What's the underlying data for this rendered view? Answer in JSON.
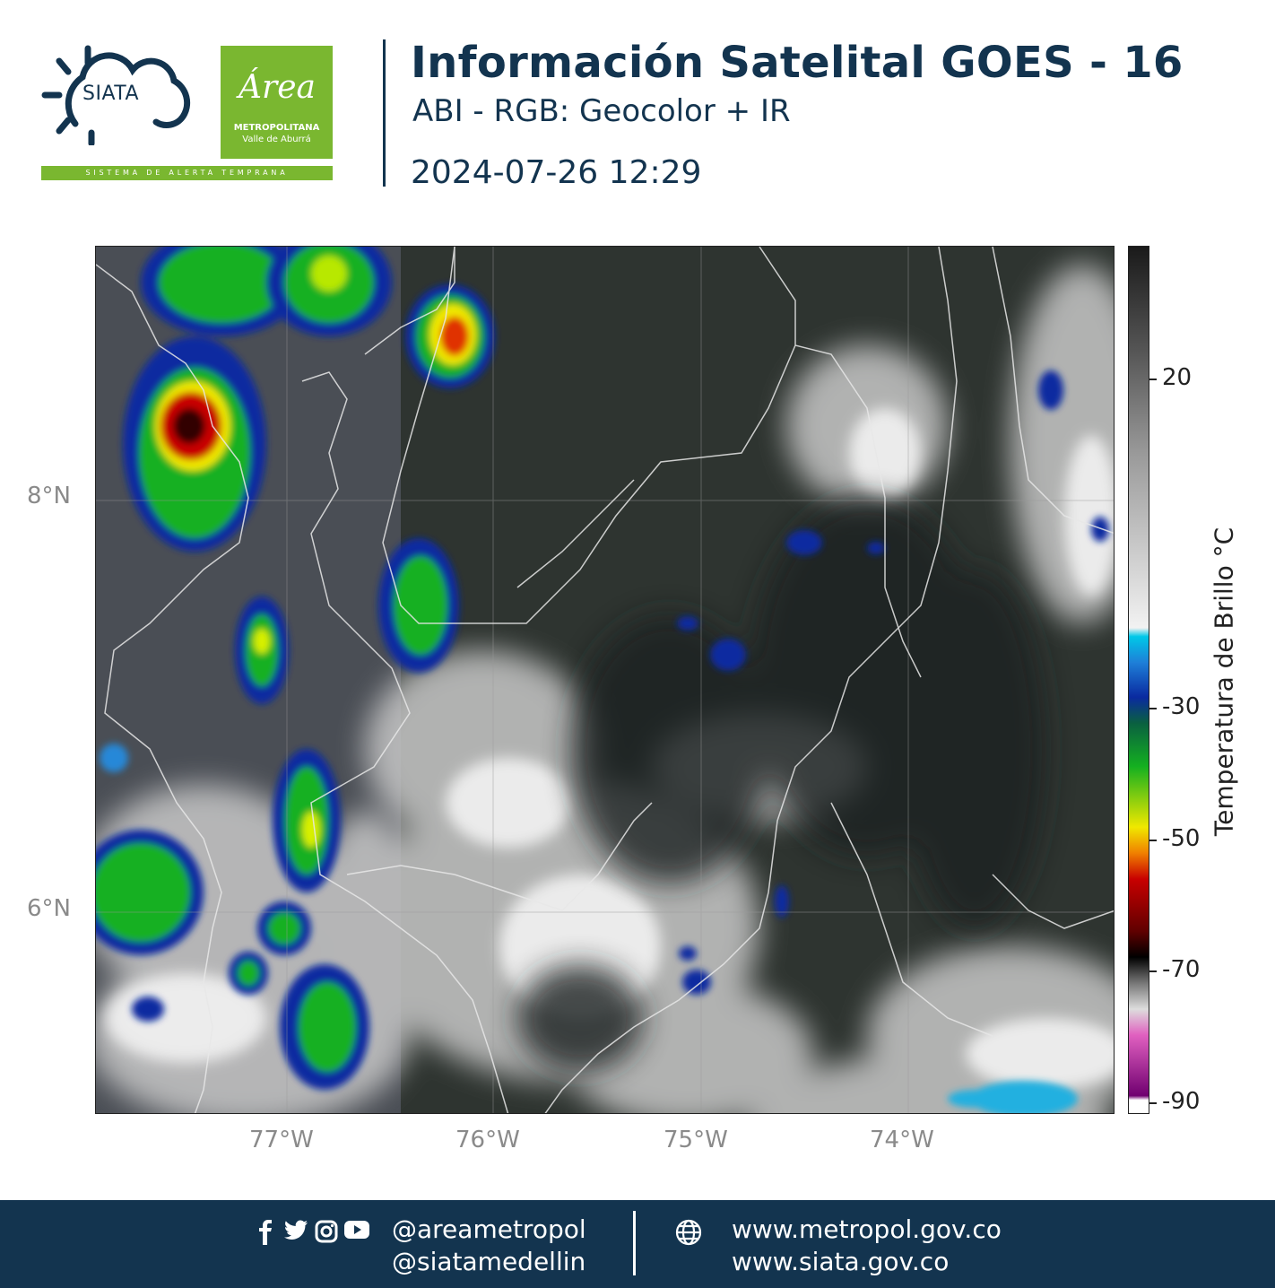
{
  "header": {
    "siata_logo_text": "SIATA",
    "area_logo": {
      "script": "Área",
      "line1": "METROPOLITANA",
      "line2": "Valle de Aburrá"
    },
    "sat_strip": "SISTEMA DE ALERTA TEMPRANA",
    "title": "Información Satelital GOES - 16",
    "subtitle": "ABI - RGB: Geocolor + IR",
    "datetime": "2024-07-26 12:29"
  },
  "map": {
    "lat_labels": [
      "8°N",
      "6°N"
    ],
    "lon_labels": [
      "77°W",
      "76°W",
      "75°W",
      "74°W"
    ]
  },
  "colorbar": {
    "title": "Temperatura de Brillo °C",
    "labels": [
      "20",
      "-30",
      "-50",
      "-70",
      "-90"
    ],
    "colors": {
      "warm": "#1a1a1a",
      "cold_gray": "#f2f2f2",
      "cyan": "#00c8e8",
      "blue": "#0a2aa0",
      "green": "#14b020",
      "yellow": "#f0e800",
      "red": "#c80000",
      "black": "#000000",
      "magenta": "#e060c0"
    }
  },
  "footer": {
    "icons": [
      "facebook-icon",
      "twitter-icon",
      "instagram-icon",
      "youtube-icon",
      "globe-icon"
    ],
    "handle1": "@areametropol",
    "handle2": "@siatamedellin",
    "url1": "www.metropol.gov.co",
    "url2": "www.siata.gov.co"
  }
}
